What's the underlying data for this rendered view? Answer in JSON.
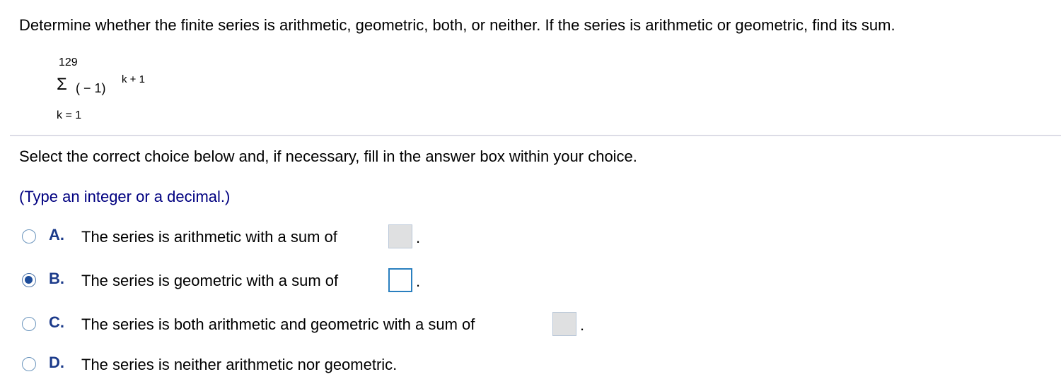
{
  "question": {
    "text": "Determine whether the finite series is arithmetic, geometric, both, or neither. If the series is arithmetic or geometric, find its sum."
  },
  "expression": {
    "upper_limit": "129",
    "sigma": "Σ",
    "term": "( − 1)",
    "exponent": "k + 1",
    "lower_limit": "k = 1"
  },
  "instruction": {
    "text": "Select the correct choice below and, if necessary, fill in the answer box within your choice."
  },
  "hint": {
    "text": "(Type an integer or a decimal.)"
  },
  "choices": [
    {
      "letter": "A.",
      "text": "The series is arithmetic with a sum of",
      "has_box": true,
      "box_value": "",
      "selected": false,
      "period": "."
    },
    {
      "letter": "B.",
      "text": "The series is geometric with a sum of",
      "has_box": true,
      "box_value": "",
      "selected": true,
      "period": "."
    },
    {
      "letter": "C.",
      "text": "The series is both arithmetic and geometric with a sum of",
      "has_box": true,
      "box_value": "",
      "selected": false,
      "period": "."
    },
    {
      "letter": "D.",
      "text": "The series is neither arithmetic nor geometric.",
      "has_box": false,
      "selected": false
    }
  ],
  "colors": {
    "hint_text": "#000080",
    "choice_letter": "#1b3a8a",
    "radio_border": "#6b95bd",
    "radio_selected_fill": "#1d4c9a",
    "answer_box_inactive": "#dfe0e1",
    "answer_box_active_border": "#2a7fbf",
    "divider": "#dcdce6"
  }
}
